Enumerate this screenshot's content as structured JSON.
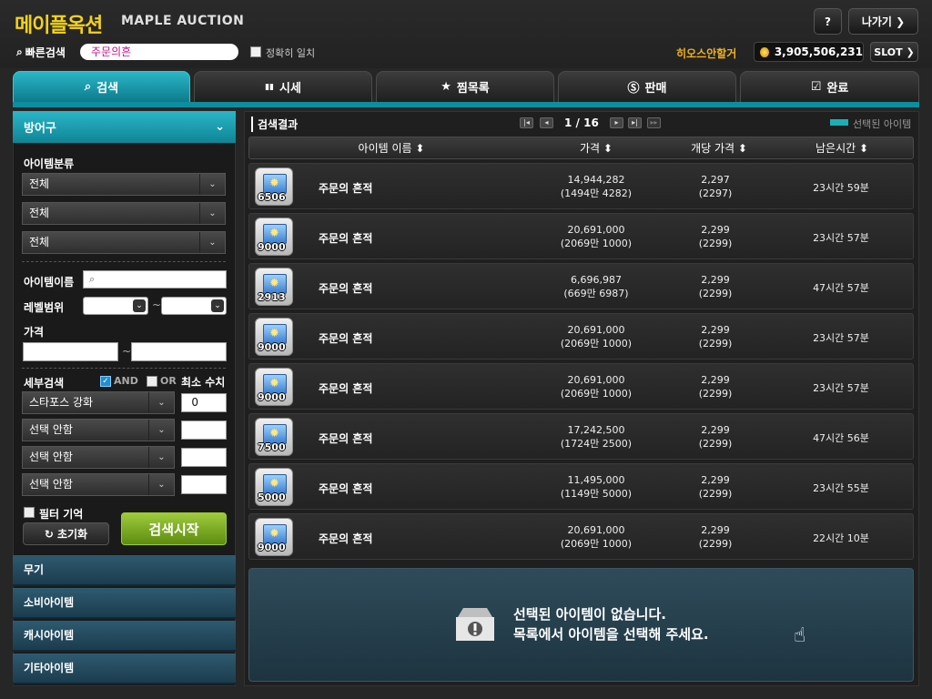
{
  "header": {
    "logo_kr": "메이플옥션",
    "logo_en": "MAPLE AUCTION",
    "help_label": "?",
    "exit_label": "나가기 ❯",
    "quick_search_label": "빠른검색",
    "quick_search_value": "주문의흔",
    "exact_match_label": "정확히 일치",
    "server_name": "히오스안할거",
    "meso": "3,905,506,231",
    "slot_label": "SLOT ❯"
  },
  "tabs": [
    {
      "icon": "⌕",
      "label": "검색"
    },
    {
      "icon": "▮▮",
      "label": "시세"
    },
    {
      "icon": "★",
      "label": "찜목록"
    },
    {
      "icon": "Ⓢ",
      "label": "판매"
    },
    {
      "icon": "☑",
      "label": "완료"
    }
  ],
  "left_panel": {
    "header": "방어구",
    "category_label": "아이템분류",
    "category_selects": [
      "전체",
      "전체",
      "전체"
    ],
    "item_name_label": "아이템이름",
    "level_range_label": "레벨범위",
    "level_sep": "~",
    "price_label": "가격",
    "price_sep": "~",
    "detail_search_label": "세부검색",
    "and_label": "AND",
    "or_label": "OR",
    "min_value_label": "최소 수치",
    "detail_rows": [
      {
        "select": "스타포스 강화",
        "value": "0"
      },
      {
        "select": "선택 안함",
        "value": ""
      },
      {
        "select": "선택 안함",
        "value": ""
      },
      {
        "select": "선택 안함",
        "value": ""
      }
    ],
    "filter_memory_label": "필터 기억",
    "reset_label": "초기화",
    "search_start_label": "검색시작",
    "categories": [
      "무기",
      "소비아이템",
      "캐시아이템",
      "기타아이템"
    ]
  },
  "results": {
    "title": "검색결과",
    "page": "1 / 16",
    "legend": "선택된 아이템",
    "columns": [
      "아이템 이름 ⬍",
      "가격 ⬍",
      "개당 가격 ⬍",
      "남은시간 ⬍"
    ],
    "rows": [
      {
        "qty": "6506",
        "name": "주문의 흔적",
        "price": "14,944,282",
        "price_sub": "(1494만 4282)",
        "unit": "2,297",
        "unit_sub": "(2297)",
        "time": "23시간 59분"
      },
      {
        "qty": "9000",
        "name": "주문의 흔적",
        "price": "20,691,000",
        "price_sub": "(2069만 1000)",
        "unit": "2,299",
        "unit_sub": "(2299)",
        "time": "23시간 57분"
      },
      {
        "qty": "2913",
        "name": "주문의 흔적",
        "price": "6,696,987",
        "price_sub": "(669만 6987)",
        "unit": "2,299",
        "unit_sub": "(2299)",
        "time": "47시간 57분"
      },
      {
        "qty": "9000",
        "name": "주문의 흔적",
        "price": "20,691,000",
        "price_sub": "(2069만 1000)",
        "unit": "2,299",
        "unit_sub": "(2299)",
        "time": "23시간 57분"
      },
      {
        "qty": "9000",
        "name": "주문의 흔적",
        "price": "20,691,000",
        "price_sub": "(2069만 1000)",
        "unit": "2,299",
        "unit_sub": "(2299)",
        "time": "23시간 57분"
      },
      {
        "qty": "7500",
        "name": "주문의 흔적",
        "price": "17,242,500",
        "price_sub": "(1724만 2500)",
        "unit": "2,299",
        "unit_sub": "(2299)",
        "time": "47시간 56분"
      },
      {
        "qty": "5000",
        "name": "주문의 흔적",
        "price": "11,495,000",
        "price_sub": "(1149만 5000)",
        "unit": "2,299",
        "unit_sub": "(2299)",
        "time": "23시간 55분"
      },
      {
        "qty": "9000",
        "name": "주문의 흔적",
        "price": "20,691,000",
        "price_sub": "(2069만 1000)",
        "unit": "2,299",
        "unit_sub": "(2299)",
        "time": "22시간 10분"
      }
    ]
  },
  "detail": {
    "line1": "선택된 아이템이 없습니다.",
    "line2": "목록에서 아이템을 선택해 주세요."
  }
}
